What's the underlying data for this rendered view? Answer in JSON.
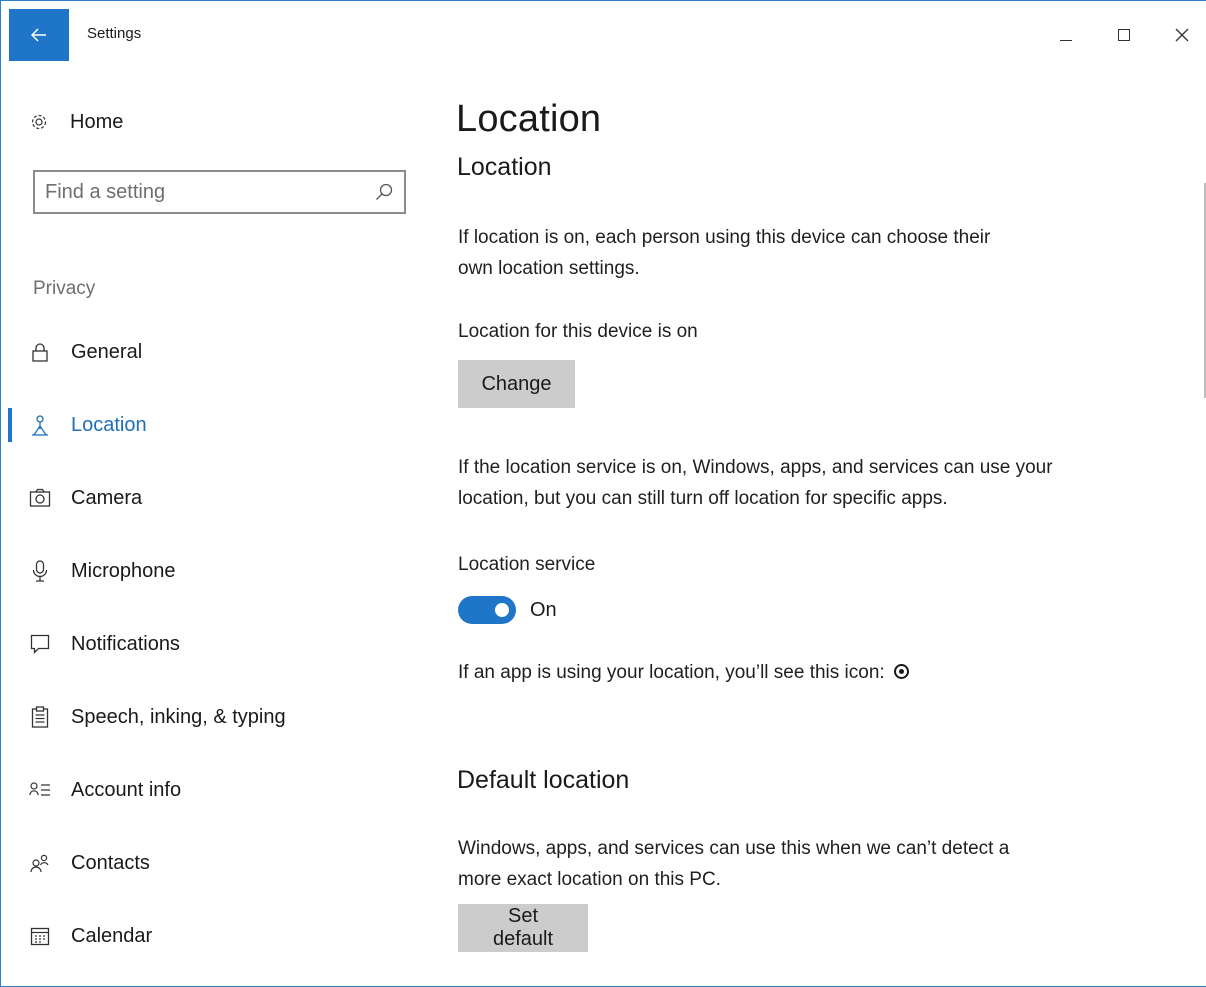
{
  "window": {
    "title": "Settings",
    "accent_color": "#1f76c9",
    "back_icon": "arrow-left-icon",
    "controls": [
      "minimize-icon",
      "maximize-icon",
      "close-icon"
    ]
  },
  "sidebar": {
    "home_label": "Home",
    "search_placeholder": "Find a setting",
    "section_label": "Privacy",
    "items": [
      {
        "label": "General",
        "icon": "lock-icon"
      },
      {
        "label": "Location",
        "icon": "location-person-icon",
        "active": true
      },
      {
        "label": "Camera",
        "icon": "camera-icon"
      },
      {
        "label": "Microphone",
        "icon": "microphone-icon"
      },
      {
        "label": "Notifications",
        "icon": "notification-icon"
      },
      {
        "label": "Speech, inking, & typing",
        "icon": "clipboard-icon"
      },
      {
        "label": "Account info",
        "icon": "account-info-icon"
      },
      {
        "label": "Contacts",
        "icon": "contacts-icon"
      },
      {
        "label": "Calendar",
        "icon": "calendar-icon"
      }
    ]
  },
  "main": {
    "page_title": "Location",
    "section1_heading": "Location",
    "section1_desc": "If location is on, each person using this device can choose their own location settings.",
    "device_status": "Location for this device is on",
    "change_button": "Change",
    "service_desc": "If the location service is on, Windows, apps, and services can use your location, but you can still turn off location for specific apps.",
    "service_label": "Location service",
    "service_toggle_state": "On",
    "icon_note": "If an app is using your location, you’ll see this icon:",
    "section2_heading": "Default location",
    "section2_desc": "Windows, apps, and services can use this when we can’t detect a more exact location on this PC.",
    "set_default_button": "Set default"
  }
}
